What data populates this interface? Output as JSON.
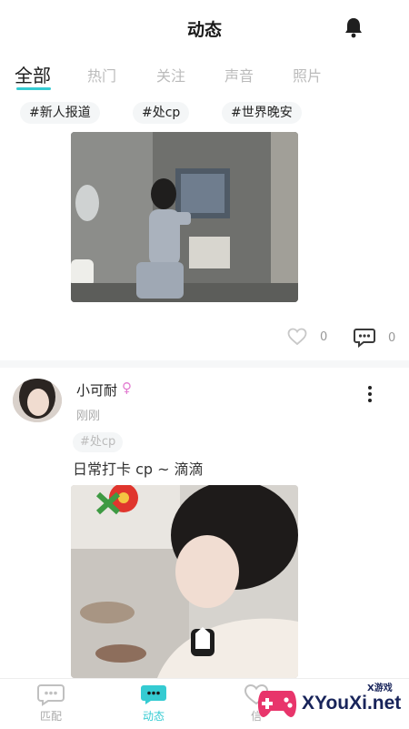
{
  "header": {
    "title": "动态"
  },
  "tabs": [
    {
      "label": "全部",
      "active": true
    },
    {
      "label": "热门",
      "active": false
    },
    {
      "label": "关注",
      "active": false
    },
    {
      "label": "声音",
      "active": false
    },
    {
      "label": "照片",
      "active": false
    }
  ],
  "topic_tags": [
    "#新人报道",
    "#处cp",
    "#世界晚安"
  ],
  "post1": {
    "likes": "0",
    "comments": "0"
  },
  "post2": {
    "username": "小可耐",
    "gender_symbol": "♀",
    "time": "刚刚",
    "tag": "#处cp",
    "text": "日常打卡 cp ~ 滴滴"
  },
  "bottom_nav": [
    {
      "label": "匹配",
      "icon": "chat-bubble-icon",
      "active": false
    },
    {
      "label": "动态",
      "icon": "moments-icon",
      "active": true
    },
    {
      "label": "信",
      "icon": "message-icon",
      "active": false
    }
  ],
  "watermark": {
    "brand": "XYouXi.net",
    "sub": "X游戏"
  },
  "colors": {
    "accent": "#35cbd2",
    "female": "#e27bd0",
    "muted": "#bbbbbb"
  }
}
